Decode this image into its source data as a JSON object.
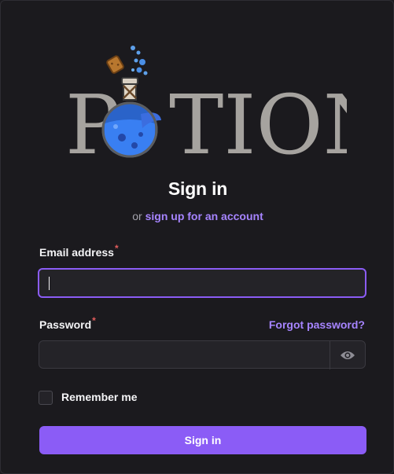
{
  "logo": {
    "wordmark": "POTION"
  },
  "heading": {
    "title": "Sign in",
    "prefix": "or",
    "signup_link": "sign up for an account"
  },
  "form": {
    "email": {
      "label": "Email address",
      "required_mark": "*",
      "value": "",
      "placeholder": ""
    },
    "password": {
      "label": "Password",
      "required_mark": "*",
      "value": "",
      "placeholder": "",
      "forgot_link": "Forgot password?",
      "toggle_icon": "eye-icon"
    },
    "remember": {
      "label": "Remember me",
      "checked": false
    },
    "submit_label": "Sign in"
  },
  "colors": {
    "background": "#1b1a1e",
    "accent": "#8b5cf6",
    "link": "#a684ff",
    "required": "#e25c5c",
    "input_bg": "#242328"
  }
}
